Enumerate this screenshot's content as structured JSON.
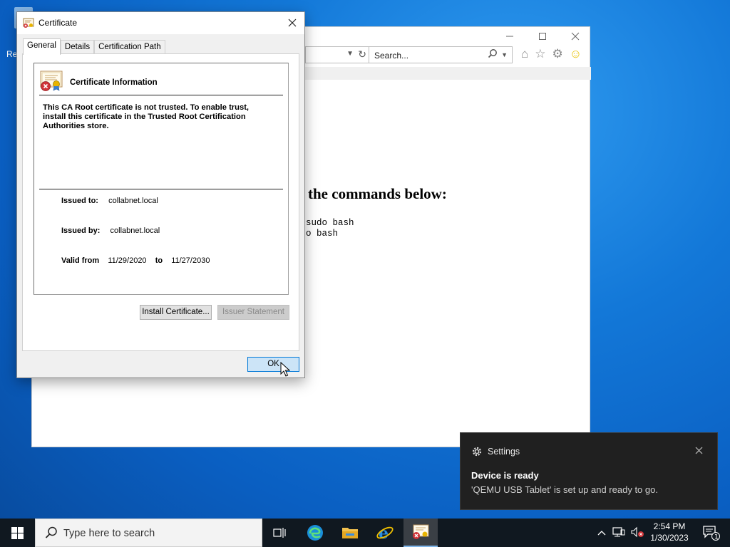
{
  "desktop": {
    "icon_label": "Re"
  },
  "browser": {
    "search_placeholder": "Search...",
    "heading_fragment": "the commands below:",
    "code_lines": [
      "sudo bash",
      "o bash"
    ],
    "caption_buttons": [
      "minimize",
      "maximize",
      "close"
    ]
  },
  "certificate_dialog": {
    "title": "Certificate",
    "tabs": [
      {
        "label": "General",
        "active": true
      },
      {
        "label": "Details",
        "active": false
      },
      {
        "label": "Certification Path",
        "active": false
      }
    ],
    "info_title": "Certificate Information",
    "warning_text": "This CA Root certificate is not trusted. To enable trust, install this certificate in the Trusted Root Certification Authorities store.",
    "issued_to_label": "Issued to:",
    "issued_to_value": "collabnet.local",
    "issued_by_label": "Issued by:",
    "issued_by_value": "collabnet.local",
    "valid_from_label": "Valid from",
    "valid_from_value": "11/29/2020",
    "valid_to_label": "to",
    "valid_to_value": "11/27/2030",
    "install_button": "Install Certificate...",
    "issuer_statement_button": "Issuer Statement",
    "ok_button": "OK"
  },
  "toast": {
    "app": "Settings",
    "heading": "Device is ready",
    "body": "'QEMU USB Tablet' is set up and ready to go."
  },
  "taskbar": {
    "search_placeholder": "Type here to search",
    "time": "2:54 PM",
    "date": "1/30/2023",
    "notification_count": "1"
  },
  "colors": {
    "desktop_blue": "#1378d8",
    "toast_bg": "#202020",
    "taskbar_bg": "#101820",
    "ok_button_accent": "#0078d7",
    "error_red": "#d13438"
  },
  "icons": [
    "windows-start-icon",
    "search-icon",
    "task-view-icon",
    "edge-icon",
    "file-explorer-icon",
    "internet-explorer-icon",
    "certificate-icon",
    "gear-icon",
    "close-icon",
    "home-icon",
    "favorites-star-icon",
    "tools-gear-icon",
    "smiley-feedback-icon",
    "refresh-icon",
    "network-icon",
    "volume-muted-icon",
    "chevron-up-icon",
    "action-center-icon"
  ]
}
